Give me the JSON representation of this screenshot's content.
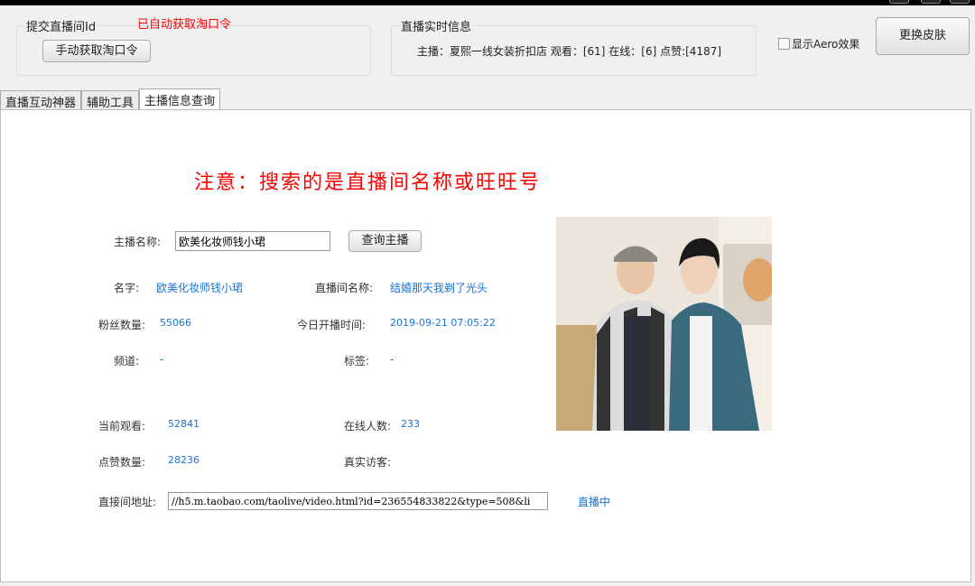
{
  "submit_group": {
    "title": "提交直播间Id",
    "status": "已自动获取淘口令",
    "manual_button": "手动获取淘口令"
  },
  "realtime_group": {
    "title": "直播实时信息",
    "info": "主播：夏熙一线女装折扣店 观看：[61] 在线：[6] 点赞:[4187]"
  },
  "aero_checkbox": {
    "label": "显示Aero效果",
    "checked": false
  },
  "skin_button": "更换皮肤",
  "tabs": [
    {
      "label": "直播互动神器"
    },
    {
      "label": "辅助工具"
    },
    {
      "label": "主播信息查询",
      "active": true
    }
  ],
  "notice": "注意：搜索的是直播间名称或旺旺号",
  "search": {
    "label": "主播名称:",
    "value": "欧美化妆师钱小珺",
    "button": "查询主播"
  },
  "fields": {
    "name": {
      "label": "名字:",
      "value": "欧美化妆师钱小珺"
    },
    "room_name": {
      "label": "直播间名称:",
      "value": "结婚那天我剃了光头"
    },
    "fans": {
      "label": "粉丝数量:",
      "value": "55066"
    },
    "start_time": {
      "label": "今日开播时间:",
      "value": "2019-09-21 07:05:22"
    },
    "channel": {
      "label": "频道:",
      "value": "-"
    },
    "tags": {
      "label": "标签:",
      "value": "-"
    },
    "viewers": {
      "label": "当前观看:",
      "value": "52841"
    },
    "online": {
      "label": "在线人数:",
      "value": "233"
    },
    "likes": {
      "label": "点赞数量:",
      "value": "28236"
    },
    "real_visitors": {
      "label": "真实访客:",
      "value": ""
    },
    "url": {
      "label": "直接间地址:",
      "value": "//h5.m.taobao.com/taolive/video.html?id=236554833822&type=508&li"
    },
    "live_status": "直播中"
  }
}
